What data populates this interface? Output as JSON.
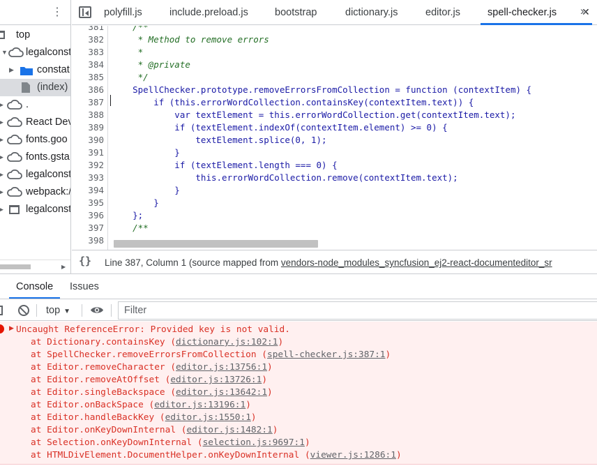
{
  "navigator": {
    "items": [
      {
        "label": "top",
        "icon": "frame-icon"
      },
      {
        "label": "legalconst",
        "icon": "cloud-icon"
      },
      {
        "label": "constat",
        "icon": "folder-icon"
      },
      {
        "label": "(index)",
        "icon": "file-icon"
      },
      {
        "label": ".",
        "icon": "cloud-icon"
      },
      {
        "label": "React Dev",
        "icon": "cloud-icon"
      },
      {
        "label": "fonts.goo",
        "icon": "cloud-icon"
      },
      {
        "label": "fonts.gsta",
        "icon": "cloud-icon"
      },
      {
        "label": "legalconst",
        "icon": "cloud-icon"
      },
      {
        "label": "webpack:/",
        "icon": "cloud-icon"
      },
      {
        "label": "legalconst",
        "icon": "frame-icon"
      }
    ]
  },
  "tabs": [
    "polyfill.js",
    "include.preload.js",
    "bootstrap",
    "dictionary.js",
    "editor.js",
    "spell-checker.js"
  ],
  "active_tab": "spell-checker.js",
  "editor": {
    "lines": [
      {
        "n": "381",
        "text": "    /**"
      },
      {
        "n": "382",
        "text": "     * Method to remove errors"
      },
      {
        "n": "383",
        "text": "     *"
      },
      {
        "n": "384",
        "text": "     * @private"
      },
      {
        "n": "385",
        "text": "     */"
      },
      {
        "n": "386",
        "text": "    SpellChecker.prototype.removeErrorsFromCollection = function (contextItem) {"
      },
      {
        "n": "387",
        "text": "        if (this.errorWordCollection.containsKey(contextItem.text)) {"
      },
      {
        "n": "388",
        "text": "            var textElement = this.errorWordCollection.get(contextItem.text);"
      },
      {
        "n": "389",
        "text": "            if (textElement.indexOf(contextItem.element) >= 0) {"
      },
      {
        "n": "390",
        "text": "                textElement.splice(0, 1);"
      },
      {
        "n": "391",
        "text": "            }"
      },
      {
        "n": "392",
        "text": "            if (textElement.length === 0) {"
      },
      {
        "n": "393",
        "text": "                this.errorWordCollection.remove(contextItem.text);"
      },
      {
        "n": "394",
        "text": "            }"
      },
      {
        "n": "395",
        "text": "        }"
      },
      {
        "n": "396",
        "text": "    };"
      },
      {
        "n": "397",
        "text": "    /**"
      },
      {
        "n": "398",
        "text": ""
      }
    ]
  },
  "status": {
    "pretty_print": "{}",
    "position": "Line 387, Column 1",
    "source_prefix": "(source mapped from ",
    "source_link": "vendors-node_modules_syncfusion_ej2-react-documenteditor_sr"
  },
  "drawer": {
    "tabs": [
      "Console",
      "Issues"
    ],
    "context": "top",
    "filter_placeholder": "Filter"
  },
  "console": {
    "error_message": "Uncaught ReferenceError: Provided key is not valid.",
    "stack": [
      {
        "fn": "at Dictionary.containsKey",
        "loc": "dictionary.js:102:1"
      },
      {
        "fn": "at SpellChecker.removeErrorsFromCollection",
        "loc": "spell-checker.js:387:1"
      },
      {
        "fn": "at Editor.removeCharacter",
        "loc": "editor.js:13756:1"
      },
      {
        "fn": "at Editor.removeAtOffset",
        "loc": "editor.js:13726:1"
      },
      {
        "fn": "at Editor.singleBackspace",
        "loc": "editor.js:13642:1"
      },
      {
        "fn": "at Editor.onBackSpace",
        "loc": "editor.js:13196:1"
      },
      {
        "fn": "at Editor.handleBackKey",
        "loc": "editor.js:1550:1"
      },
      {
        "fn": "at Editor.onKeyDownInternal",
        "loc": "editor.js:1482:1"
      },
      {
        "fn": "at Selection.onKeyDownInternal",
        "loc": "selection.js:9697:1"
      },
      {
        "fn": "at HTMLDivElement.DocumentHelper.onKeyDownInternal",
        "loc": "viewer.js:1286:1"
      }
    ]
  },
  "colors": {
    "accent": "#1a73e8",
    "error_text": "#d93025",
    "error_bg": "#fff0f0",
    "comment": "#236e25",
    "keyword": "#aa0d91"
  }
}
